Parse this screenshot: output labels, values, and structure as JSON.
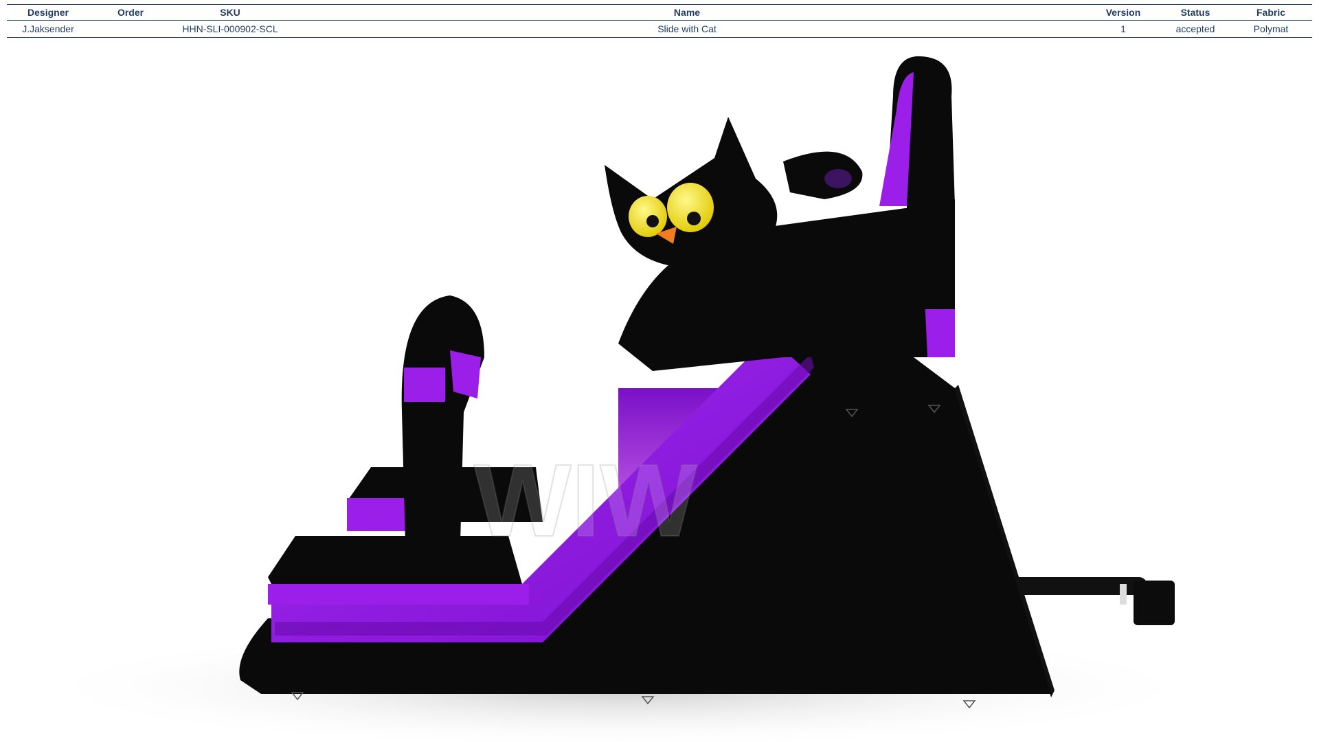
{
  "spec_table": {
    "headers": [
      "Designer",
      "Order",
      "SKU",
      "Name",
      "Version",
      "Status",
      "Fabric"
    ],
    "row": {
      "designer": "J.Jaksender",
      "order": "",
      "sku": "HHN-SLI-000902-SCL",
      "name": "Slide with Cat",
      "version": "1",
      "status": "accepted",
      "fabric": "Polymat"
    }
  },
  "render": {
    "watermark": "WIW",
    "colors": {
      "body": "#0a0a0a",
      "accent": "#9b1fe8",
      "panel_light": "#e9a6f5",
      "cat_eye": "#f5e21b",
      "cat_nose": "#f07d1e"
    }
  }
}
